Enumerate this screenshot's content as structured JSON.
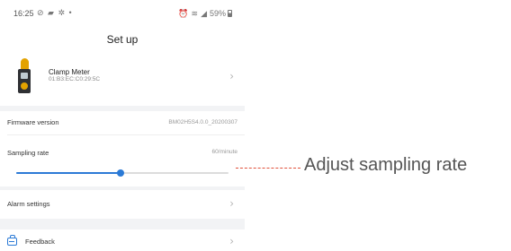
{
  "status_bar": {
    "time": "16:25",
    "left_icons": "⊘ ▰ ✲ •",
    "right_text": "59%"
  },
  "header": {
    "title": "Set up"
  },
  "device": {
    "name": "Clamp Meter",
    "mac": "01:B3:EC:C0:29:5C"
  },
  "settings": {
    "firmware_label": "Firmware version",
    "firmware_value": "BM02H5S4.0.0_20200307",
    "sampling_label": "Sampling rate",
    "sampling_value": "60/minute",
    "sampling_slider_fraction": 0.49,
    "alarm_label": "Alarm settings",
    "feedback_label": "Feedback"
  },
  "annotation": {
    "text": "Adjust sampling rate"
  },
  "icons": {
    "chevron": "chevron-right-icon",
    "feedback": "feedback-icon",
    "device": "clamp-meter-icon"
  },
  "colors": {
    "accent": "#2b7ad6",
    "annotation_line": "#e0503a",
    "section_gap": "#f2f3f5"
  }
}
